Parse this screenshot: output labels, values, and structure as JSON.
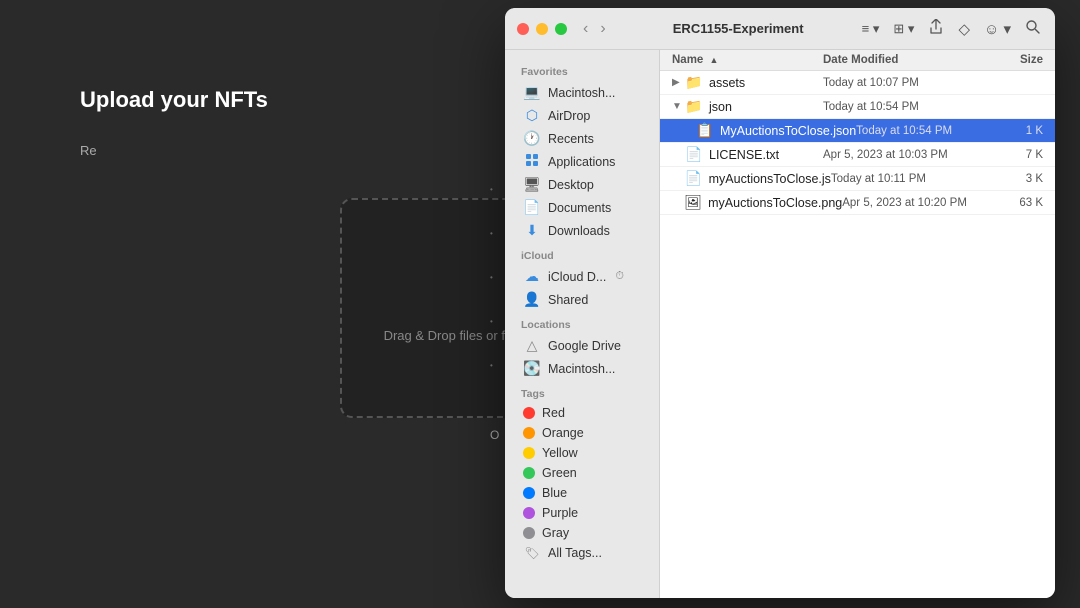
{
  "background": {
    "title": "Upload your NFTs",
    "upload_text": "Drag & Drop files or folders here, or click to select files"
  },
  "finder": {
    "window_title": "ERC1155-Experiment",
    "traffic_lights": [
      "red",
      "yellow",
      "green"
    ],
    "nav": {
      "back_label": "‹",
      "forward_label": "›"
    },
    "toolbar": {
      "list_view": "≡",
      "grid_view": "⊞",
      "share": "↑",
      "tag": "◇",
      "action": "☺",
      "search": "⌕"
    },
    "columns": {
      "name": "Name",
      "date_modified": "Date Modified",
      "size": "Size"
    },
    "files": [
      {
        "id": "assets",
        "name": "assets",
        "type": "folder",
        "indent": 0,
        "expanded": true,
        "date": "Today at 10:07 PM",
        "size": ""
      },
      {
        "id": "json",
        "name": "json",
        "type": "folder",
        "indent": 0,
        "expanded": true,
        "date": "Today at 10:54 PM",
        "size": ""
      },
      {
        "id": "myAuctionsToClose.json",
        "name": "MyAuctionsToClose.json",
        "type": "json",
        "indent": 1,
        "selected": true,
        "date": "Today at 10:54 PM",
        "size": "1 K"
      },
      {
        "id": "LICENSE.txt",
        "name": "LICENSE.txt",
        "type": "txt",
        "indent": 0,
        "date": "Apr 5, 2023 at 10:03 PM",
        "size": "7 K"
      },
      {
        "id": "myAuctionsToClose.js",
        "name": "myAuctionsToClose.js",
        "type": "js",
        "indent": 0,
        "date": "Today at 10:11 PM",
        "size": "3 K"
      },
      {
        "id": "myAuctionsToClose.png",
        "name": "myAuctionsToClose.png",
        "type": "png",
        "indent": 0,
        "date": "Apr 5, 2023 at 10:20 PM",
        "size": "63 K"
      }
    ],
    "sidebar": {
      "favorites_label": "Favorites",
      "icloud_label": "iCloud",
      "locations_label": "Locations",
      "tags_label": "Tags",
      "items": [
        {
          "id": "macintosh",
          "label": "Macintosh...",
          "icon": "💻"
        },
        {
          "id": "airdrop",
          "label": "AirDrop",
          "icon": "📡"
        },
        {
          "id": "recents",
          "label": "Recents",
          "icon": "🕐"
        },
        {
          "id": "applications",
          "label": "Applications",
          "icon": "📱"
        },
        {
          "id": "desktop",
          "label": "Desktop",
          "icon": "🖥"
        },
        {
          "id": "documents",
          "label": "Documents",
          "icon": "📄"
        },
        {
          "id": "downloads",
          "label": "Downloads",
          "icon": "⬇"
        },
        {
          "id": "icloud-drive",
          "label": "iCloud D...",
          "icon": "☁"
        },
        {
          "id": "shared",
          "label": "Shared",
          "icon": "👤"
        },
        {
          "id": "google-drive",
          "label": "Google Drive",
          "icon": "△"
        },
        {
          "id": "macintosh2",
          "label": "Macintosh...",
          "icon": "💽"
        }
      ],
      "tags": [
        {
          "id": "red",
          "label": "Red",
          "color": "#ff3b30"
        },
        {
          "id": "orange",
          "label": "Orange",
          "color": "#ff9500"
        },
        {
          "id": "yellow",
          "label": "Yellow",
          "color": "#ffcc00"
        },
        {
          "id": "green",
          "label": "Green",
          "color": "#34c759"
        },
        {
          "id": "blue",
          "label": "Blue",
          "color": "#007aff"
        },
        {
          "id": "purple",
          "label": "Purple",
          "color": "#af52de"
        },
        {
          "id": "gray",
          "label": "Gray",
          "color": "#8e8e93"
        },
        {
          "id": "all-tags",
          "label": "All Tags...",
          "icon": "🏷"
        }
      ]
    }
  }
}
